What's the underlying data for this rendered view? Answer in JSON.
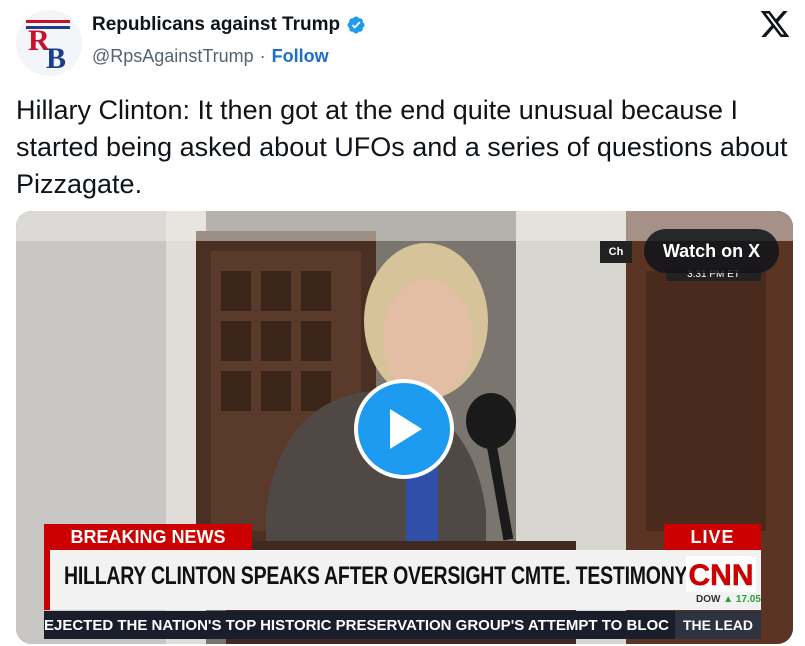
{
  "author": {
    "display_name": "Republicans against Trump",
    "handle": "@RpsAgainstTrump",
    "separator": "·",
    "follow_label": "Follow",
    "avatar_text": "RB"
  },
  "tweet": {
    "text": "Hillary Clinton: It then got at the end quite unusual because I started being asked about UFOs and a series of questions about Pizzagate."
  },
  "media": {
    "watch_label": "Watch on X",
    "channel_tag": "Ch",
    "time_tag": "3:31 PM ET",
    "breaking_label": "BREAKING NEWS",
    "live_label": "LIVE",
    "headline": "HILLARY CLINTON SPEAKS AFTER OVERSIGHT CMTE. TESTIMONY",
    "network_logo": "CNN",
    "dow_label": "DOW",
    "dow_change": "▲ 17.05",
    "ticker_text": "EJECTED THE NATION'S TOP HISTORIC PRESERVATION GROUP'S ATTEMPT TO BLOCK T",
    "show_label": "THE LEAD"
  },
  "colors": {
    "follow_blue": "#1d6fc9",
    "verified_blue": "#1d9bf0",
    "play_blue": "#1d9bf0",
    "cnn_red": "#cc0000",
    "ticker_bg": "#1a1d2b"
  },
  "icons": [
    "verified-badge-icon",
    "x-logo-icon",
    "play-icon"
  ]
}
